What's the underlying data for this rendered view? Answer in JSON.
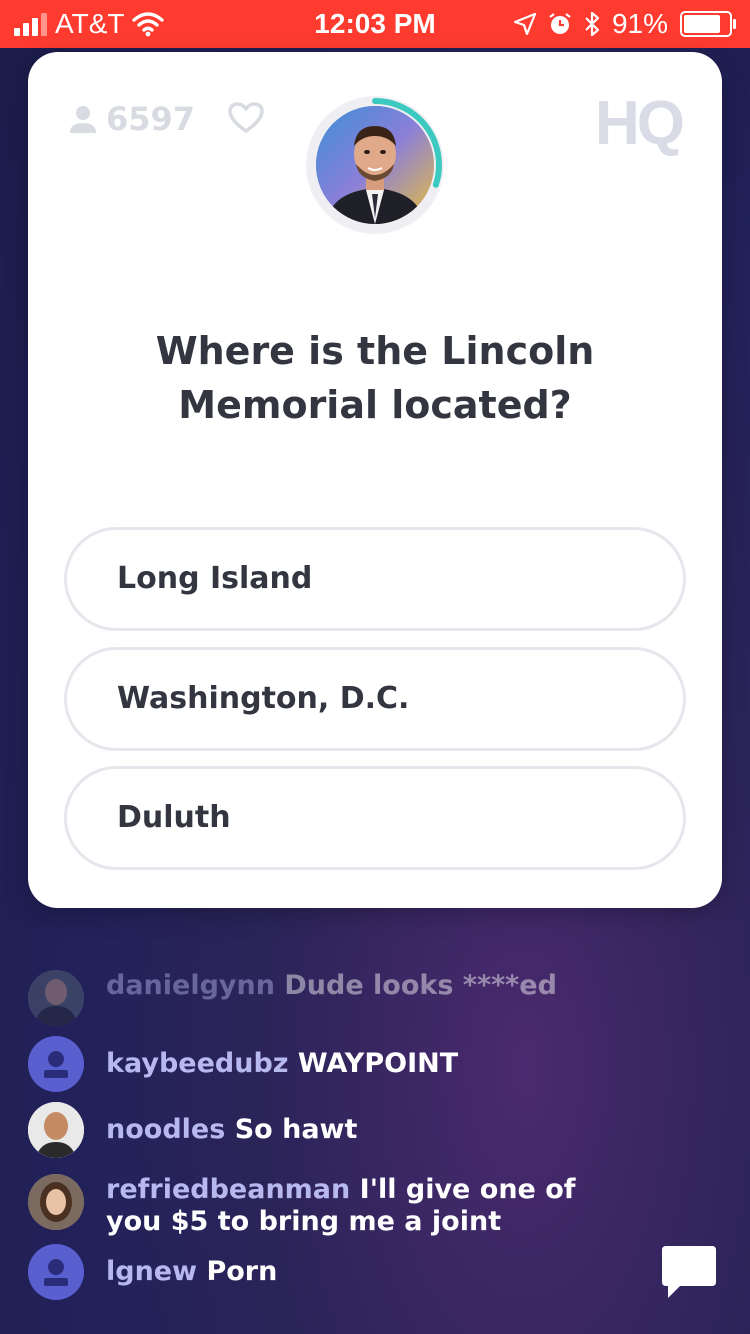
{
  "status_bar": {
    "carrier": "AT&T",
    "time": "12:03 PM",
    "battery": "91%",
    "battery_level": 0.91
  },
  "header": {
    "viewer_count": "6597",
    "logo": "HQ",
    "host_timer_progress": 0.3
  },
  "question": {
    "text": "Where is the Lincoln Memorial located?"
  },
  "answers": [
    {
      "label": "Long Island"
    },
    {
      "label": "Washington, D.C."
    },
    {
      "label": "Duluth"
    }
  ],
  "chat": {
    "messages": [
      {
        "user": "danielgynn",
        "text": "Dude looks ****ed"
      },
      {
        "user": "kaybeedubz",
        "text": "WAYPOINT"
      },
      {
        "user": "noodles",
        "text": "So hawt"
      },
      {
        "user": "refriedbeanman",
        "text": "I'll give one of you $5 to bring me a joint"
      },
      {
        "user": "lgnew",
        "text": "Porn"
      }
    ]
  },
  "colors": {
    "status_bar": "#ff3b30",
    "username": "#b6b8ef",
    "timer_ring": "#3cc9c0",
    "default_avatar": "#5a5fd0"
  },
  "icons": [
    "signal-icon",
    "wifi-icon",
    "location-icon",
    "alarm-icon",
    "bluetooth-icon",
    "battery-icon",
    "person-icon",
    "heart-icon",
    "chat-bubble-icon"
  ]
}
